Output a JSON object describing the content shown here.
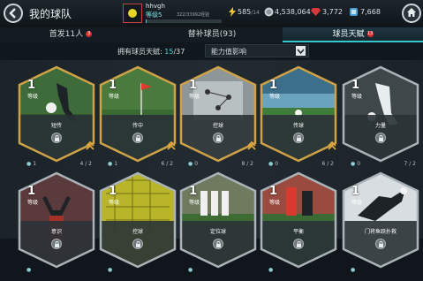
{
  "header": {
    "title": "我的球队",
    "username": "hhvgh",
    "user_level": "等级5",
    "xp_text": "322/33992经验",
    "xp_fraction": 0.01,
    "energy": "585",
    "energy_max": "/14",
    "coins": "4,538,064",
    "gems": "3,772",
    "tokens": "7,668"
  },
  "tabs": [
    {
      "label": "首发11人",
      "badge": "3"
    },
    {
      "label": "替补球员(93)",
      "badge": ""
    },
    {
      "label": "球员天赋",
      "badge": "13"
    }
  ],
  "filter": {
    "owned_label": "拥有球员天赋:",
    "owned_count": "15",
    "owned_total": "/37",
    "sort_option": "能力值影响"
  },
  "level_word": "等级",
  "cards": [
    {
      "level": "1",
      "name": "短传",
      "count": "1",
      "progress": "4 / 2",
      "highlight": true,
      "img": "shoot",
      "bg": "#3e6b3a"
    },
    {
      "level": "1",
      "name": "传中",
      "count": "1",
      "progress": "6 / 2",
      "highlight": true,
      "img": "flag",
      "bg": "#4a7a3d"
    },
    {
      "level": "1",
      "name": "控球",
      "count": "0",
      "progress": "8 / 2",
      "highlight": true,
      "img": "tactics",
      "bg": "#8d9699"
    },
    {
      "level": "1",
      "name": "传球",
      "count": "0",
      "progress": "6 / 2",
      "highlight": true,
      "img": "stadium",
      "bg": "#3c6f8a"
    },
    {
      "level": "1",
      "name": "力量",
      "count": "0",
      "progress": "7 / 2",
      "highlight": false,
      "img": "kick",
      "bg": "#4b5458"
    },
    {
      "level": "1",
      "name": "意识",
      "count": "",
      "progress": "",
      "highlight": false,
      "img": "celebrate",
      "bg": "#5a3a3a"
    },
    {
      "level": "1",
      "name": "控球",
      "count": "",
      "progress": "",
      "highlight": false,
      "img": "net",
      "bg": "#b8b52a"
    },
    {
      "level": "1",
      "name": "定位球",
      "count": "",
      "progress": "",
      "highlight": false,
      "img": "wall",
      "bg": "#6f7a5f"
    },
    {
      "level": "1",
      "name": "平衡",
      "count": "",
      "progress": "",
      "highlight": false,
      "img": "players",
      "bg": "#9a4b3f"
    },
    {
      "level": "1",
      "name": "门将鱼跃扑救",
      "count": "",
      "progress": "",
      "highlight": false,
      "img": "keeper",
      "bg": "#d7dde0"
    }
  ]
}
